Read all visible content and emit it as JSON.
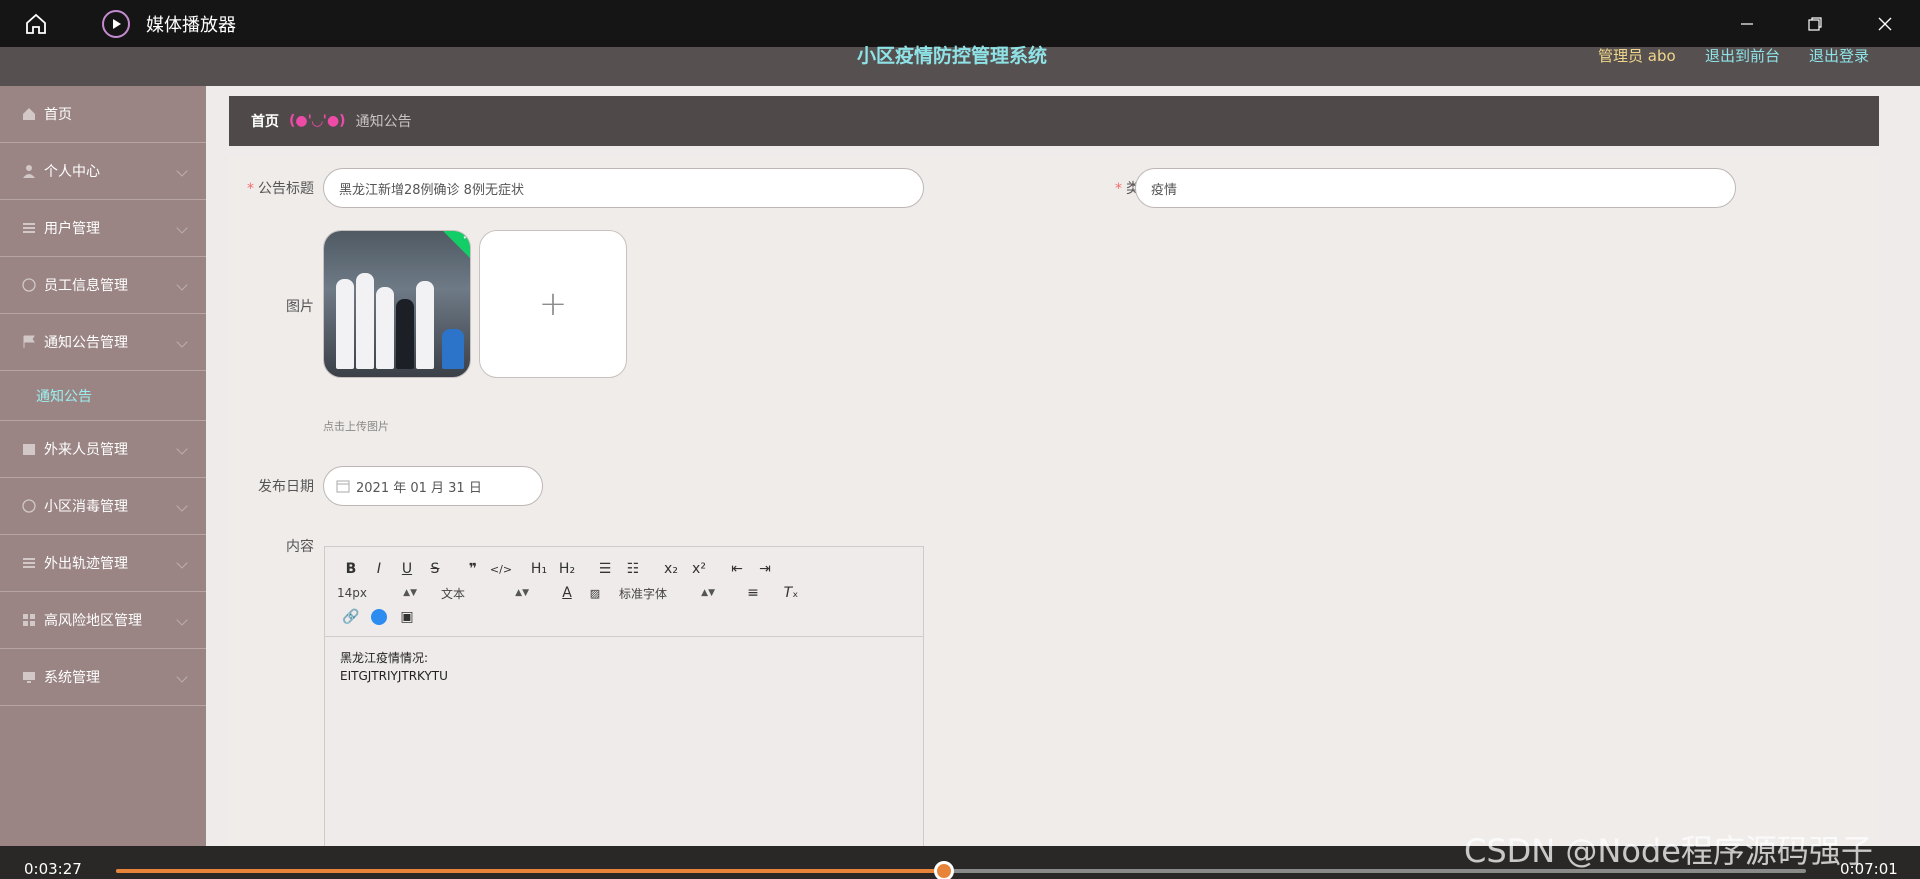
{
  "player": {
    "title": "媒体播放器",
    "elapsed": "0:03:27",
    "total": "0:07:01",
    "progress": 0.49
  },
  "header": {
    "system_title": "小区疫情防控管理系统",
    "admin": "管理员 abo",
    "exit_front": "退出到前台",
    "logout": "退出登录"
  },
  "sidebar": {
    "items": [
      {
        "label": "首页",
        "icon": "home-icon"
      },
      {
        "label": "个人中心",
        "icon": "user-icon"
      },
      {
        "label": "用户管理",
        "icon": "list-icon"
      },
      {
        "label": "员工信息管理",
        "icon": "check-circle-icon"
      },
      {
        "label": "通知公告管理",
        "icon": "flag-icon"
      },
      {
        "label": "外来人员管理",
        "icon": "calendar-icon"
      },
      {
        "label": "小区消毒管理",
        "icon": "circle-icon"
      },
      {
        "label": "外出轨迹管理",
        "icon": "list-icon"
      },
      {
        "label": "高风险地区管理",
        "icon": "grid-icon"
      },
      {
        "label": "系统管理",
        "icon": "monitor-icon"
      }
    ],
    "active_sub": "通知公告"
  },
  "breadcrumb": {
    "home": "首页",
    "separator": "(●'◡'●)",
    "current": "通知公告"
  },
  "form": {
    "title_label": "公告标题",
    "title_value": "黑龙江新增28例确诊 8例无症状",
    "type_label": "类型",
    "type_value": "疫情",
    "image_label": "图片",
    "upload_tip": "点击上传图片",
    "date_label": "发布日期",
    "date_value": "2021 年 01 月 31 日",
    "content_label": "内容"
  },
  "editor": {
    "font_size": "14px",
    "heading_select": "文本",
    "font_family": "标准字体",
    "content_lines": [
      "黑龙江疫情情况:",
      "EITGJTRIYJTRKYTU"
    ]
  },
  "watermark": "CSDN @Node程序源码强子",
  "colors": {
    "accent_teal": "#8ee3e7",
    "progress_orange": "#e8843a",
    "sidebar": "#9a8584"
  }
}
